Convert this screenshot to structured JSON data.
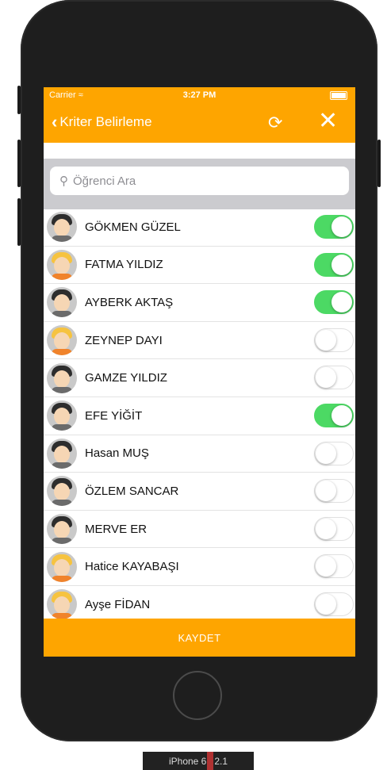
{
  "status_bar": {
    "carrier": "Carrier",
    "time": "3:27 PM"
  },
  "navbar": {
    "back_label": "Kriter Belirleme",
    "refresh_icon": "refresh-icon",
    "close_icon": "close-icon"
  },
  "search": {
    "placeholder": "Öğrenci Ara"
  },
  "students": [
    {
      "name": "GÖKMEN GÜZEL",
      "on": true,
      "avatar": "boy"
    },
    {
      "name": "FATMA YILDIZ",
      "on": true,
      "avatar": "girl"
    },
    {
      "name": "AYBERK AKTAŞ",
      "on": true,
      "avatar": "boy"
    },
    {
      "name": "ZEYNEP DAYI",
      "on": false,
      "avatar": "girl"
    },
    {
      "name": "GAMZE YILDIZ",
      "on": false,
      "avatar": "boy"
    },
    {
      "name": "EFE YİĞİT",
      "on": true,
      "avatar": "boy"
    },
    {
      "name": "Hasan MUŞ",
      "on": false,
      "avatar": "boy"
    },
    {
      "name": "ÖZLEM SANCAR",
      "on": false,
      "avatar": "boy"
    },
    {
      "name": "MERVE ER",
      "on": false,
      "avatar": "boy"
    },
    {
      "name": "Hatice KAYABAŞI",
      "on": false,
      "avatar": "girl"
    },
    {
      "name": "Ayşe FİDAN",
      "on": false,
      "avatar": "girl"
    }
  ],
  "save_button": {
    "label": "KAYDET"
  },
  "device_label": {
    "left": "iPhone 6",
    "right": "2.1"
  },
  "colors": {
    "accent": "#fea500",
    "toggle_on": "#4cd964",
    "device_body": "#1e1e1e"
  }
}
